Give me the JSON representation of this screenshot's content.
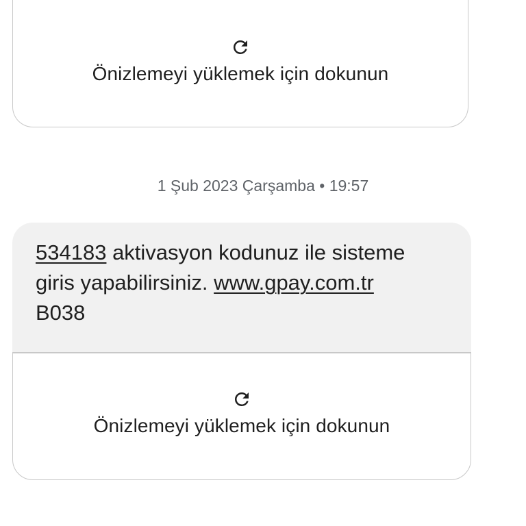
{
  "preview_top": {
    "icon": "reload-icon",
    "label": "Önizlemeyi yüklemek için dokunun"
  },
  "date_separator": "1 Şub 2023 Çarşamba • 19:57",
  "message": {
    "code": "534183",
    "text_part1": " aktivasyon kodunuz ile sisteme",
    "text_part2": "giris yapabilirsiniz. ",
    "url": "www.gpay.com.tr",
    "text_part3": "B038"
  },
  "preview_bottom": {
    "icon": "reload-icon",
    "label": "Önizlemeyi yüklemek için dokunun"
  }
}
